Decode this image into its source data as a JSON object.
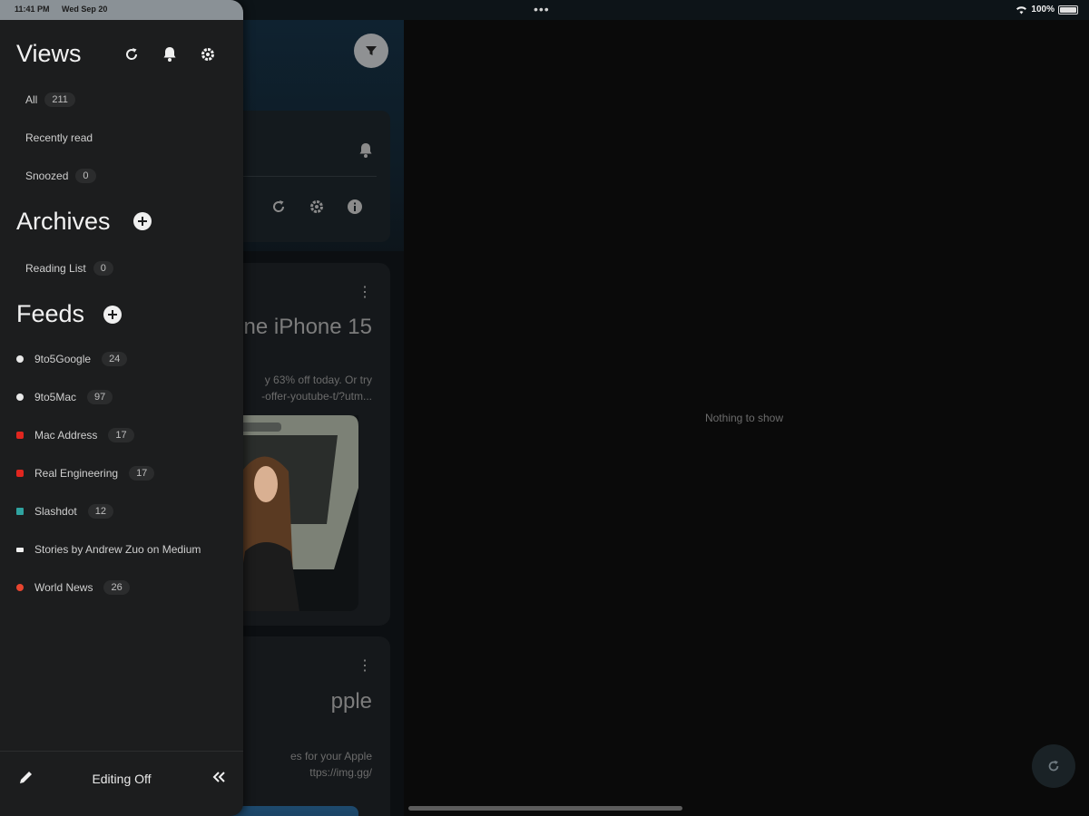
{
  "status": {
    "time": "11:41 PM",
    "date": "Wed Sep 20",
    "battery": "100%",
    "dots": "•••"
  },
  "sidebar": {
    "views_title": "Views",
    "views": [
      {
        "label": "All",
        "count": "211"
      },
      {
        "label": "Recently read",
        "count": null
      },
      {
        "label": "Snoozed",
        "count": "0"
      }
    ],
    "archives_title": "Archives",
    "archives": [
      {
        "label": "Reading List",
        "count": "0"
      }
    ],
    "feeds_title": "Feeds",
    "feeds": [
      {
        "label": "9to5Google",
        "count": "24",
        "color": "#e8e8e8"
      },
      {
        "label": "9to5Mac",
        "count": "97",
        "color": "#e8e8e8"
      },
      {
        "label": "Mac Address",
        "count": "17",
        "color": "#e0261f"
      },
      {
        "label": "Real Engineering",
        "count": "17",
        "color": "#e0261f"
      },
      {
        "label": "Slashdot",
        "count": "12",
        "color": "#2fa3a0"
      },
      {
        "label": "Stories by Andrew Zuo on Medium",
        "count": null,
        "color": "#f0f0f0"
      },
      {
        "label": "World News",
        "count": "26",
        "color": "#e8452f"
      }
    ],
    "footer": {
      "editing_label": "Editing Off"
    }
  },
  "list": {
    "card1": {
      "title": "ne iPhone 15",
      "line1": "y 63% off today. Or try",
      "line2": "-offer-youtube-t/?utm..."
    },
    "card2": {
      "title": "pple",
      "line1": "es for your Apple",
      "line2": "ttps://img.gg/"
    }
  },
  "content": {
    "empty_text": "Nothing to show"
  }
}
